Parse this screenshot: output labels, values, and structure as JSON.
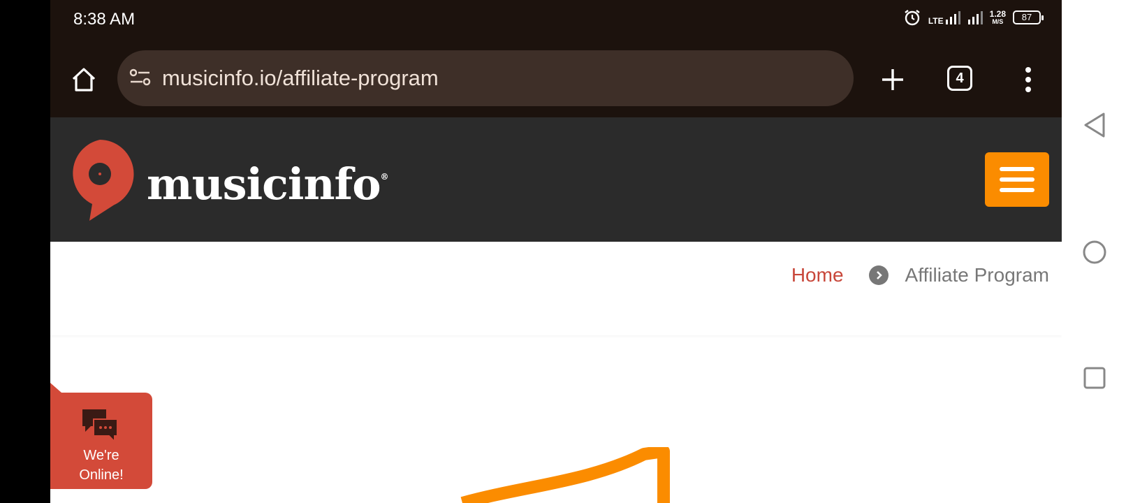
{
  "status_bar": {
    "time": "8:38 AM",
    "network_label": "LTE",
    "speed_value": "1.28",
    "speed_unit": "M/S",
    "battery": "87"
  },
  "browser": {
    "url": "musicinfo.io/affiliate-program",
    "tab_count": "4"
  },
  "site": {
    "logo_text": "musicinfo",
    "logo_mark": "®",
    "brand_color": "#d34a39",
    "accent_color": "#fb8c00"
  },
  "breadcrumb": {
    "home": "Home",
    "current": "Affiliate Program"
  },
  "chat_widget": {
    "line1": "We're",
    "line2": "Online!"
  },
  "icons": {
    "home": "home-icon",
    "tune": "site-info-icon",
    "plus": "plus-icon",
    "menu": "more-vert-icon",
    "back": "back-triangle-icon",
    "home_nav": "home-circle-icon",
    "recents": "recents-square-icon"
  }
}
